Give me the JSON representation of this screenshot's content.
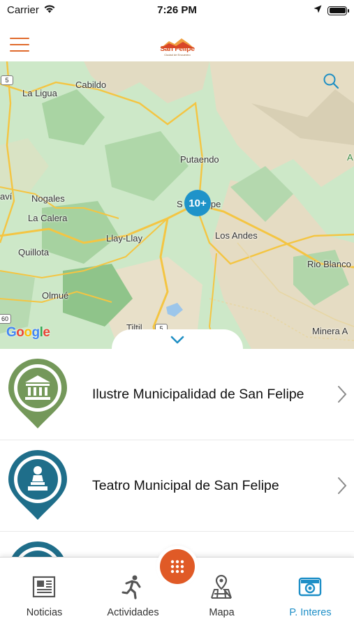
{
  "status_bar": {
    "carrier": "Carrier",
    "time": "7:26 PM",
    "icons": [
      "wifi-icon",
      "location-arrow-icon",
      "battery-icon"
    ]
  },
  "header": {
    "menu_icon": "hamburger-menu-icon",
    "logo_text": "San Felipe",
    "logo_subtext": "Ciudad de Encuentro",
    "accent_color": "#e06a2b"
  },
  "map": {
    "labels": {
      "la_ligua": "La Ligua",
      "cabildo": "Cabildo",
      "putaendo": "Putaendo",
      "avi": "aví",
      "nogales": "Nogales",
      "la_calera": "La Calera",
      "san_felipe_left": "S",
      "san_felipe_right": "ipe",
      "los_andes": "Los Andes",
      "llay_llay": "Llay-Llay",
      "quillota": "Quillota",
      "rio_blanco": "Rio Blanco",
      "olmue": "Olmué",
      "tiltil": "Tiltil",
      "minera_a": "Minera A",
      "edge_a": "A"
    },
    "route_shields": {
      "north": "5",
      "south": "5",
      "west": "60"
    },
    "cluster_label": "10+",
    "google_logo": "Google",
    "search_icon": "search-icon",
    "collapse_icon": "chevron-down-icon"
  },
  "list": {
    "items": [
      {
        "label": "Ilustre Municipalidad de San Felipe",
        "icon": "building-pin-icon",
        "color": "#74985a"
      },
      {
        "label": "Teatro Municipal de San Felipe",
        "icon": "monument-pin-icon",
        "color": "#1f6e8a"
      },
      {
        "label": "",
        "icon": "person-pin-icon",
        "color": "#1f6e8a"
      }
    ]
  },
  "tabbar": {
    "tabs": [
      {
        "label": "Noticias",
        "icon": "newspaper-icon"
      },
      {
        "label": "Actividades",
        "icon": "runner-icon"
      },
      {
        "label": "Mapa",
        "icon": "map-pin-icon"
      },
      {
        "label": "P. Interes",
        "icon": "camera-icon",
        "active": true
      }
    ],
    "center_button_icon": "grid-dots-icon",
    "active_color": "#1e8fc7",
    "center_color": "#e05a26"
  }
}
